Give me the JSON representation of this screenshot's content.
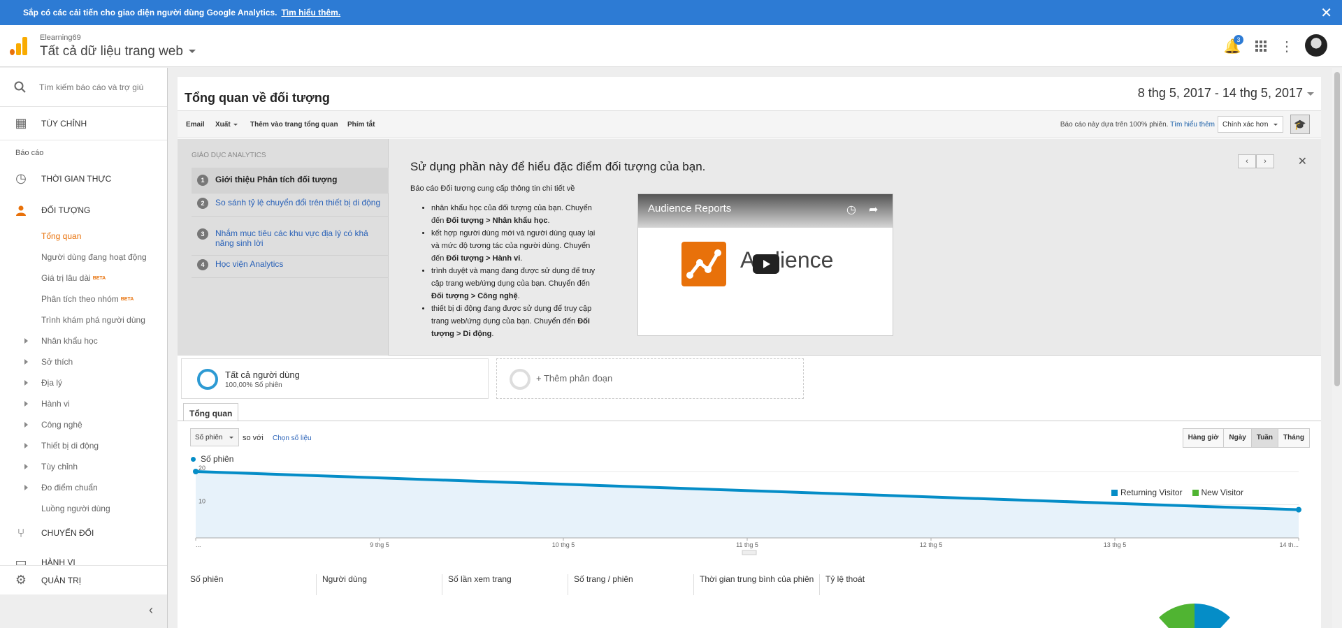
{
  "banner": {
    "text": "Sắp có các cải tiến cho giao diện người dùng Google Analytics.",
    "link": "Tìm hiểu thêm."
  },
  "header": {
    "account": "Elearning69",
    "view": "Tất cả dữ liệu trang web",
    "notification_count": "3"
  },
  "sidebar": {
    "search_placeholder": "Tìm kiếm báo cáo và trợ giúp",
    "custom": "TÙY CHỈNH",
    "reports_label": "Báo cáo",
    "realtime": "THỜI GIAN THỰC",
    "audience": "ĐỐI TƯỢNG",
    "audience_items": [
      {
        "label": "Tổng quan"
      },
      {
        "label": "Người dùng đang hoạt động"
      },
      {
        "label": "Giá trị lâu dài",
        "badge": "BETA"
      },
      {
        "label": "Phân tích theo nhóm",
        "badge": "BETA"
      },
      {
        "label": "Trình khám phá người dùng"
      },
      {
        "label": "Nhân khẩu học"
      },
      {
        "label": "Sở thích"
      },
      {
        "label": "Địa lý"
      },
      {
        "label": "Hành vi"
      },
      {
        "label": "Công nghệ"
      },
      {
        "label": "Thiết bị di động"
      },
      {
        "label": "Tùy chỉnh"
      },
      {
        "label": "Đo điểm chuẩn"
      },
      {
        "label": "Luồng người dùng"
      }
    ],
    "conversions": "CHUYỂN ĐỔI",
    "behavior": "HÀNH VI",
    "admin": "QUẢN TRỊ"
  },
  "main": {
    "title": "Tổng quan về đối tượng",
    "date_range": "8 thg 5, 2017 - 14 thg 5, 2017",
    "toolbar": {
      "email": "Email",
      "export": "Xuất",
      "add_dashboard": "Thêm vào trang tổng quan",
      "shortcut": "Phím tắt",
      "note": "Báo cáo này dựa trên 100% phiên.",
      "note_link": "Tìm hiểu thêm",
      "precision": "Chính xác hơn"
    },
    "edu": {
      "heading": "GIÁO DỤC ANALYTICS",
      "items": [
        {
          "num": "1",
          "label": "Giới thiệu Phân tích đối tượng"
        },
        {
          "num": "2",
          "label": "So sánh tỷ lệ chuyển đổi trên thiết bị di động"
        },
        {
          "num": "3",
          "label": "Nhắm mục tiêu các khu vực địa lý có khả năng sinh lời"
        },
        {
          "num": "4",
          "label": "Học viện Analytics"
        }
      ],
      "title": "Sử dụng phần này để hiểu đặc điểm đối tượng của bạn.",
      "intro": "Báo cáo Đối tượng cung cấp thông tin chi tiết về",
      "bullets": [
        {
          "text": "nhân khẩu học của đối tượng của bạn. Chuyển đến ",
          "bold": "Đối tượng > Nhân khẩu học"
        },
        {
          "text": "kết hợp người dùng mới và người dùng quay lại và mức độ tương tác của người dùng. Chuyển đến ",
          "bold": "Đối tượng > Hành vi"
        },
        {
          "text": "trình duyệt và mạng đang được sử dụng để truy cập trang web/ứng dụng của bạn. Chuyển đến ",
          "bold": "Đối tượng > Công nghệ"
        },
        {
          "text": "thiết bị di động đang được sử dụng để truy cập trang web/ứng dụng của bạn. Chuyển đến ",
          "bold": "Đối tượng > Di động"
        }
      ],
      "video_title": "Audience Reports",
      "video_logo_text": "Audience"
    },
    "segments": {
      "all_users": "Tất cả người dùng",
      "all_users_sub": "100,00% Số phiên",
      "add_segment": "+ Thêm phân đoạn"
    },
    "tab": "Tổng quan",
    "metric_select": "Số phiên",
    "compare": "so với",
    "choose_metric": "Chọn số liệu",
    "periods": [
      "Hàng giờ",
      "Ngày",
      "Tuần",
      "Tháng"
    ],
    "selected_period": "Tuần",
    "metrics": [
      "Số phiên",
      "Người dùng",
      "Số lần xem trang",
      "Số trang / phiên",
      "Thời gian trung bình của phiên",
      "Tỷ lệ thoát"
    ],
    "pie_legend": [
      {
        "name": "Returning Visitor",
        "color": "#058dc7"
      },
      {
        "name": "New Visitor",
        "color": "#50b432"
      }
    ]
  },
  "chart_data": {
    "type": "area",
    "series": [
      {
        "name": "Số phiên",
        "values": [
          20,
          8.5
        ]
      }
    ],
    "x": [
      "...",
      "14 th..."
    ],
    "x_ticks": [
      "...",
      "9 thg 5",
      "10 thg 5",
      "11 thg 5",
      "12 thg 5",
      "13 thg 5",
      "14 th..."
    ],
    "y_ticks": [
      "20",
      "10"
    ],
    "ylim": [
      0,
      20
    ],
    "color": "#058dc7"
  }
}
